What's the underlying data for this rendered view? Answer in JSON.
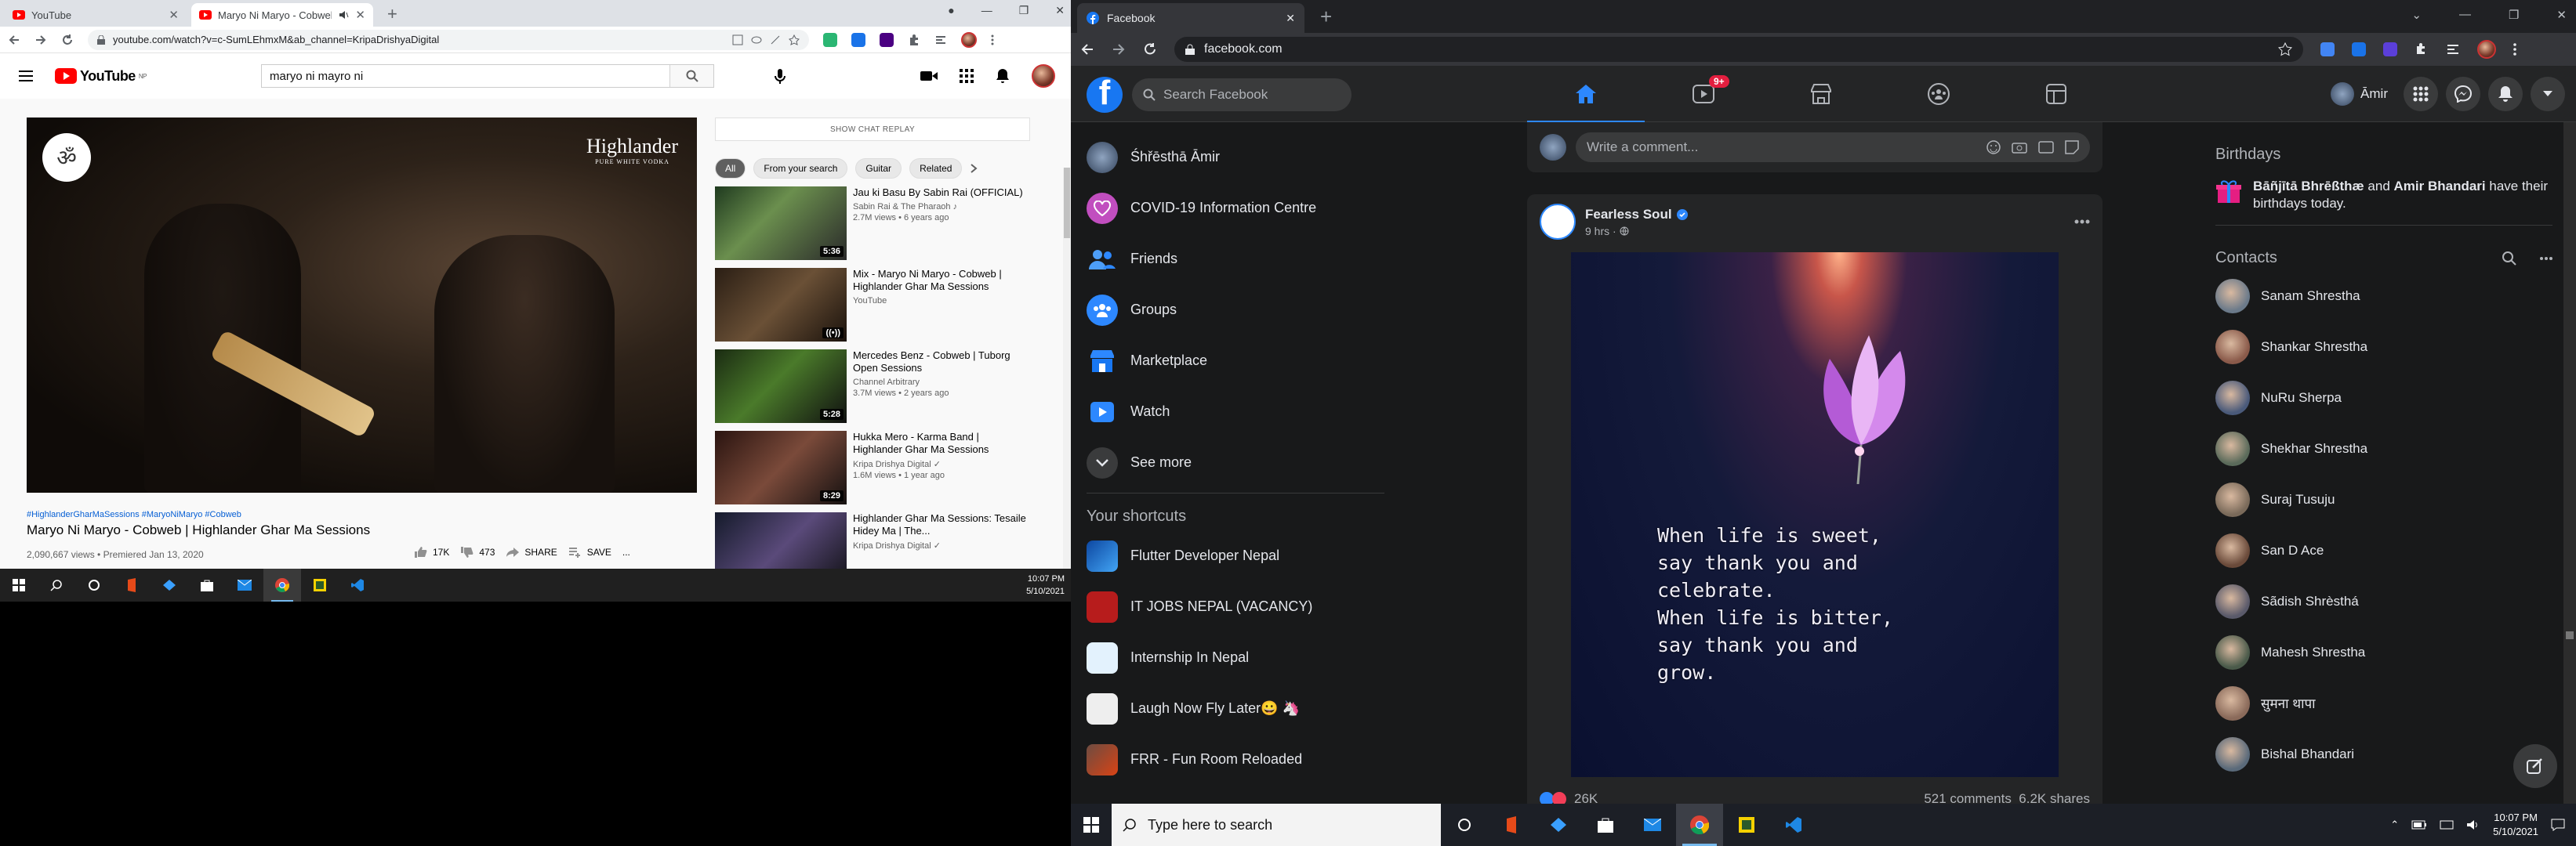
{
  "left": {
    "tabs": [
      {
        "title": "YouTube",
        "active": false
      },
      {
        "title": "Maryo Ni Maryo - Cobweb |",
        "active": true
      }
    ],
    "url": "youtube.com/watch?v=c-SumLEhmxM&ab_channel=KripaDrishyaDigital",
    "youtube": {
      "logo_text": "YouTube",
      "logo_region": "NP",
      "search_value": "maryo ni mayro ni",
      "player": {
        "brand": "Highlander",
        "brand_sub": "PURE WHITE VODKA",
        "badge_glyph": "ॐ"
      },
      "hashtags": "#HighlanderGharMaSessions #MaryoNiMaryo #Cobweb",
      "title": "Maryo Ni Maryo - Cobweb | Highlander Ghar Ma Sessions",
      "meta": "2,090,667 views • Premiered Jan 13, 2020",
      "likes": "17K",
      "dislikes": "473",
      "share_label": "SHARE",
      "save_label": "SAVE",
      "more_label": "...",
      "chat_replay": "SHOW CHAT REPLAY",
      "chips": [
        "All",
        "From your search",
        "Guitar",
        "Related"
      ],
      "suggestions": [
        {
          "title": "Jau ki Basu By Sabin Rai (OFFICIAL)",
          "channel": "Sabin Rai & The Pharaoh ♪",
          "views": "2.7M views • 6 years ago",
          "duration": "5:36"
        },
        {
          "title": "Mix - Maryo Ni Maryo - Cobweb | Highlander Ghar Ma Sessions",
          "channel": "YouTube",
          "views": "",
          "duration": "((•))"
        },
        {
          "title": "Mercedes Benz - Cobweb | Tuborg Open Sessions",
          "channel": "Channel Arbitrary",
          "views": "3.7M views • 2 years ago",
          "duration": "5:28"
        },
        {
          "title": "Hukka Mero - Karma Band | Highlander Ghar Ma Sessions",
          "channel": "Kripa Drishya Digital ✓",
          "views": "1.6M views • 1 year ago",
          "duration": "8:29"
        },
        {
          "title": "Highlander Ghar Ma Sessions: Tesaile Hidey Ma | The...",
          "channel": "Kripa Drishya Digital ✓",
          "views": "",
          "duration": ""
        }
      ]
    },
    "taskbar": {
      "time": "10:07 PM",
      "date": "5/10/2021"
    }
  },
  "right": {
    "tab_title": "Facebook",
    "url": "facebook.com",
    "facebook": {
      "search_placeholder": "Search Facebook",
      "watch_badge": "9+",
      "profile_name": "Āmir",
      "left_nav": [
        {
          "label": "Śhřēsthā Āmir",
          "icon": "avatar"
        },
        {
          "label": "COVID-19 Information Centre",
          "icon": "covid-heart-icon"
        },
        {
          "label": "Friends",
          "icon": "friends-icon"
        },
        {
          "label": "Groups",
          "icon": "groups-icon"
        },
        {
          "label": "Marketplace",
          "icon": "marketplace-icon"
        },
        {
          "label": "Watch",
          "icon": "watch-icon"
        },
        {
          "label": "See more",
          "icon": "chevron-down-icon"
        }
      ],
      "shortcuts_heading": "Your shortcuts",
      "shortcuts": [
        "Flutter Developer Nepal",
        "IT JOBS NEPAL (VACANCY)",
        "Internship In Nepal",
        "Laugh Now Fly Later😀 🦄",
        "FRR - Fun Room Reloaded"
      ],
      "comment_placeholder": "Write a comment...",
      "post": {
        "author": "Fearless Soul",
        "time": "9 hrs · ",
        "quote": "When life is sweet,\nsay thank you and\ncelebrate.\nWhen life is bitter,\nsay thank you and\ngrow.",
        "reactions": "26K",
        "comments_shares": "521 comments  6.2K shares"
      },
      "birthdays_heading": "Birthdays",
      "birthday_name1": "Bāñjītā Bhrēßthæ",
      "birthday_mid": " and ",
      "birthday_name2": "Amir Bhandari",
      "birthday_suffix": " have their birthdays today.",
      "contacts_heading": "Contacts",
      "contacts": [
        "Sanam Shrestha",
        "Shankar Shrestha",
        "NuRu Sherpa",
        "Shekhar Shrestha",
        "Suraj Tusuju",
        "San D Ace",
        "Sãdish Shrèsthá",
        "Mahesh Shrestha",
        "सुमना थापा",
        "Bishal Bhandari"
      ]
    },
    "taskbar": {
      "search_placeholder": "Type here to search",
      "time": "10:07 PM",
      "date": "5/10/2021"
    }
  },
  "colors": {
    "fb_blue": "#1877f2",
    "yt_red": "#ff0000",
    "fb_dark": "#18191a",
    "fb_card": "#242526"
  }
}
